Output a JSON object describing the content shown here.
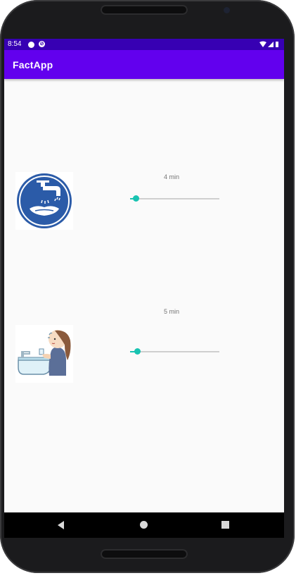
{
  "status_bar": {
    "time": "8:54"
  },
  "app_bar": {
    "title": "FactApp"
  },
  "rows": [
    {
      "image_icon": "hand-washing-sign-icon",
      "time_label": "4 min",
      "slider_fraction": 0.06
    },
    {
      "image_icon": "person-at-sink-illustration",
      "time_label": "5 min",
      "slider_fraction": 0.08
    }
  ],
  "colors": {
    "app_bar": "#6200ee",
    "status_bar": "#3700b3",
    "slider_accent": "#18c3b1"
  }
}
